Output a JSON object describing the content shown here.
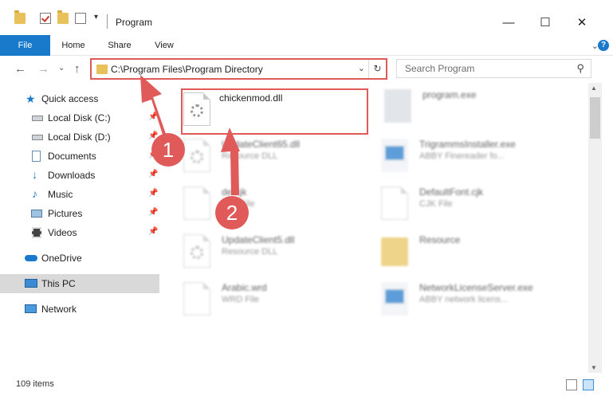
{
  "titlebar": {
    "title": "Program",
    "minimize": "—",
    "maximize": "☐",
    "close": "✕"
  },
  "ribbon": {
    "tabs": [
      "File",
      "Home",
      "Share",
      "View"
    ],
    "expand": "⌄",
    "help": "?"
  },
  "nav": {
    "back": "←",
    "forward": "→",
    "recent": "⌄",
    "up": "↑",
    "address": "C:\\Program Files\\Program Directory",
    "refresh": "↻",
    "search_placeholder": "Search Program",
    "search_icon": "search-icon"
  },
  "sidebar": {
    "items": [
      {
        "label": "Quick access",
        "icon": "star-icon"
      },
      {
        "label": "Local Disk (C:)",
        "icon": "drive-icon"
      },
      {
        "label": "Local Disk (D:)",
        "icon": "drive-icon"
      },
      {
        "label": "Documents",
        "icon": "documents-icon"
      },
      {
        "label": "Downloads",
        "icon": "download-icon"
      },
      {
        "label": "Music",
        "icon": "music-icon"
      },
      {
        "label": "Pictures",
        "icon": "pictures-icon"
      },
      {
        "label": "Videos",
        "icon": "videos-icon"
      },
      {
        "label": "OneDrive",
        "icon": "cloud-icon"
      },
      {
        "label": "This PC",
        "icon": "computer-icon"
      },
      {
        "label": "Network",
        "icon": "network-icon"
      }
    ]
  },
  "files": [
    {
      "name": "chickenmod.dll",
      "type": ""
    },
    {
      "name": "program.exe",
      "type": ""
    },
    {
      "name": "UpdateClient65.dll",
      "type": "Resource DLL"
    },
    {
      "name": "TrigrammsInstaller.exe",
      "type": "ABBY Finereader fo..."
    },
    {
      "name": "de.cjk",
      "type": "CJK File"
    },
    {
      "name": "DefaultFont.cjk",
      "type": "CJK File"
    },
    {
      "name": "UpdateClient5.dll",
      "type": "Resource DLL"
    },
    {
      "name": "Resource",
      "type": ""
    },
    {
      "name": "Arabic.wrd",
      "type": "WRD File"
    },
    {
      "name": "NetworkLicenseServer.exe",
      "type": "ABBY network licens..."
    }
  ],
  "status": {
    "item_count": "109 items"
  },
  "annotations": [
    "1",
    "2"
  ],
  "colors": {
    "accent": "#1979ca",
    "highlight": "#e05a5a",
    "folder": "#e8c15a"
  }
}
